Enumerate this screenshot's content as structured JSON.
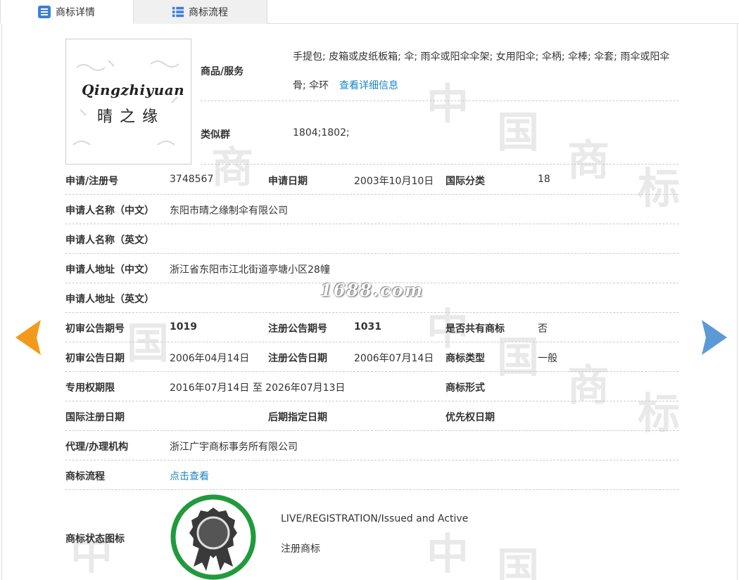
{
  "tabs": [
    {
      "label": "商标详情",
      "active": true,
      "icon": "list-doc-icon"
    },
    {
      "label": "商标流程",
      "active": false,
      "icon": "grid-list-icon"
    }
  ],
  "logo": {
    "script_text": "Qingzhiyuan",
    "cn_text": "晴之缘"
  },
  "goods": {
    "label": "商品/服务",
    "line1": "手提包; 皮箱或皮纸板箱; 伞; 雨伞或阳伞伞架; 女用阳伞; 伞柄; 伞棒; 伞套; 雨伞或阳伞",
    "line2": "骨; 伞环",
    "detail_link": "查看详细信息"
  },
  "similar": {
    "label": "类似群",
    "value": "1804;1802;"
  },
  "fields": {
    "reg_no_label": "申请/注册号",
    "reg_no": "3748567",
    "apply_date_label": "申请日期",
    "apply_date": "2003年10月10日",
    "intl_class_label": "国际分类",
    "intl_class": "18",
    "applicant_cn_label": "申请人名称（中文）",
    "applicant_cn": "东阳市晴之缘制伞有限公司",
    "applicant_en_label": "申请人名称（英文）",
    "address_cn_label": "申请人地址（中文）",
    "address_cn": "浙江省东阳市江北街道亭塘小区28幢",
    "address_en_label": "申请人地址（英文）",
    "prelim_no_label": "初审公告期号",
    "prelim_no": "1019",
    "reg_pub_no_label": "注册公告期号",
    "reg_pub_no": "1031",
    "shared_label": "是否共有商标",
    "shared": "否",
    "prelim_date_label": "初审公告日期",
    "prelim_date": "2006年04月14日",
    "reg_pub_date_label": "注册公告日期",
    "reg_pub_date": "2006年07月14日",
    "tm_type_label": "商标类型",
    "tm_type": "一般",
    "exclusive_label": "专用权期限",
    "exclusive": "2016年07月14日 至 2026年07月13日",
    "tm_form_label": "商标形式",
    "intl_reg_date_label": "国际注册日期",
    "later_date_label": "后期指定日期",
    "priority_date_label": "优先权日期",
    "agent_label": "代理/办理机构",
    "agent": "浙江广宇商标事务所有限公司",
    "flow_label": "商标流程",
    "flow_link": "点击查看",
    "status_label": "商标状态图标",
    "status_en": "LIVE/REGISTRATION/Issued and Active",
    "status_cn": "注册商标"
  },
  "watermark": {
    "site": "1688.com"
  },
  "colors": {
    "link": "#1a84c6",
    "arrow_left": "#f39a1e",
    "arrow_right": "#5b9bd5",
    "badge_ring": "#1f9a3c",
    "tab_icon": "#3d7fd4"
  }
}
